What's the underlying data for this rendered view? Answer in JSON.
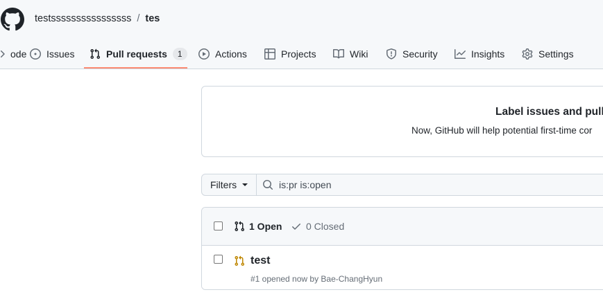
{
  "repo": {
    "owner": "testssssssssssssssss",
    "separator": "/",
    "name": "tes"
  },
  "tabs": [
    {
      "label": "ode",
      "icon": "code-icon"
    },
    {
      "label": "Issues",
      "icon": "issue-opened-icon"
    },
    {
      "label": "Pull requests",
      "icon": "git-pull-request-icon",
      "counter": "1",
      "selected": true
    },
    {
      "label": "Actions",
      "icon": "play-icon"
    },
    {
      "label": "Projects",
      "icon": "table-icon"
    },
    {
      "label": "Wiki",
      "icon": "book-icon"
    },
    {
      "label": "Security",
      "icon": "shield-icon"
    },
    {
      "label": "Insights",
      "icon": "graph-icon"
    },
    {
      "label": "Settings",
      "icon": "gear-icon"
    }
  ],
  "banner": {
    "title": "Label issues and pull r",
    "text": "Now, GitHub will help potential first-time cor"
  },
  "filter": {
    "button_label": "Filters",
    "search_value": "is:pr is:open"
  },
  "list": {
    "open_label": "1 Open",
    "closed_label": "0 Closed",
    "items": [
      {
        "title": "test",
        "meta": "#1 opened now by Bae-ChangHyun"
      }
    ]
  },
  "colors": {
    "selected_underline": "#fd8c73",
    "open_pr_icon": "#bf8700",
    "header_bg": "#f6f8fa",
    "border": "#d0d7de"
  }
}
